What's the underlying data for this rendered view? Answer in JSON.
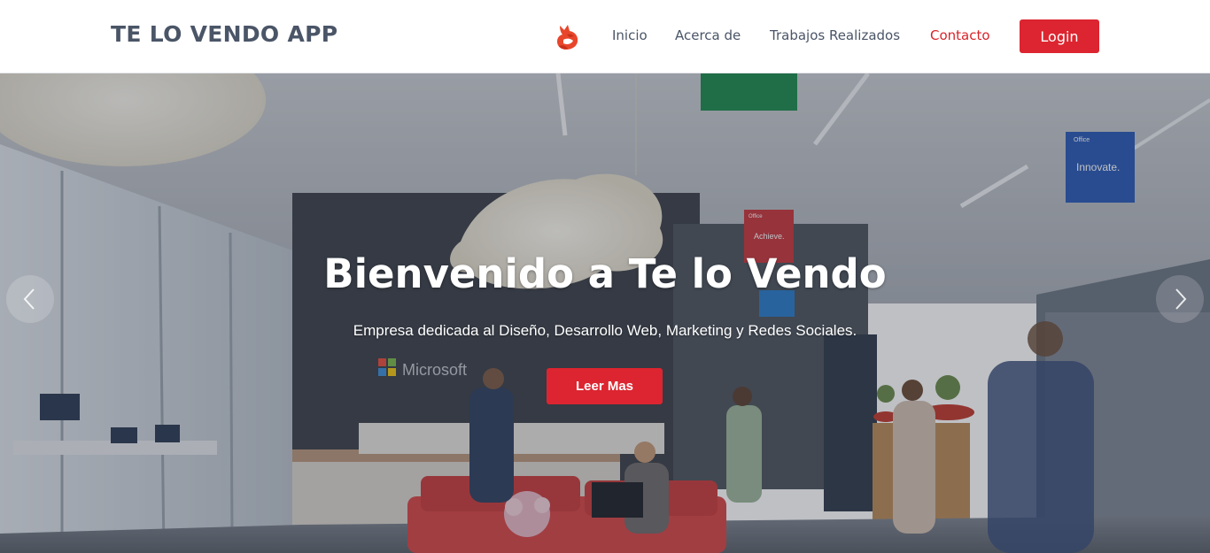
{
  "navbar": {
    "brand": "TE LO VENDO APP",
    "logo_icon": "fox-logo-icon",
    "links": [
      {
        "label": "Inicio",
        "active": false
      },
      {
        "label": "Acerca de",
        "active": false
      },
      {
        "label": "Trabajos Realizados",
        "active": false
      },
      {
        "label": "Contacto",
        "active": true
      }
    ],
    "login_label": "Login"
  },
  "hero": {
    "title": "Bienvenido a Te lo Vendo",
    "subtitle": "Empresa dedicada al Diseño, Desarrollo Web, Marketing y Redes Sociales.",
    "cta_label": "Leer Mas",
    "prev_icon": "chevron-left-icon",
    "next_icon": "chevron-right-icon",
    "background_signs": {
      "microsoft": "Microsoft",
      "office_left": "Office",
      "office_left_word": "Achieve.",
      "office_right": "Office",
      "office_right_word": "Innovate."
    }
  },
  "colors": {
    "accent": "#dc2530",
    "brand_text": "#4a5567",
    "active_link": "#d8232a"
  }
}
